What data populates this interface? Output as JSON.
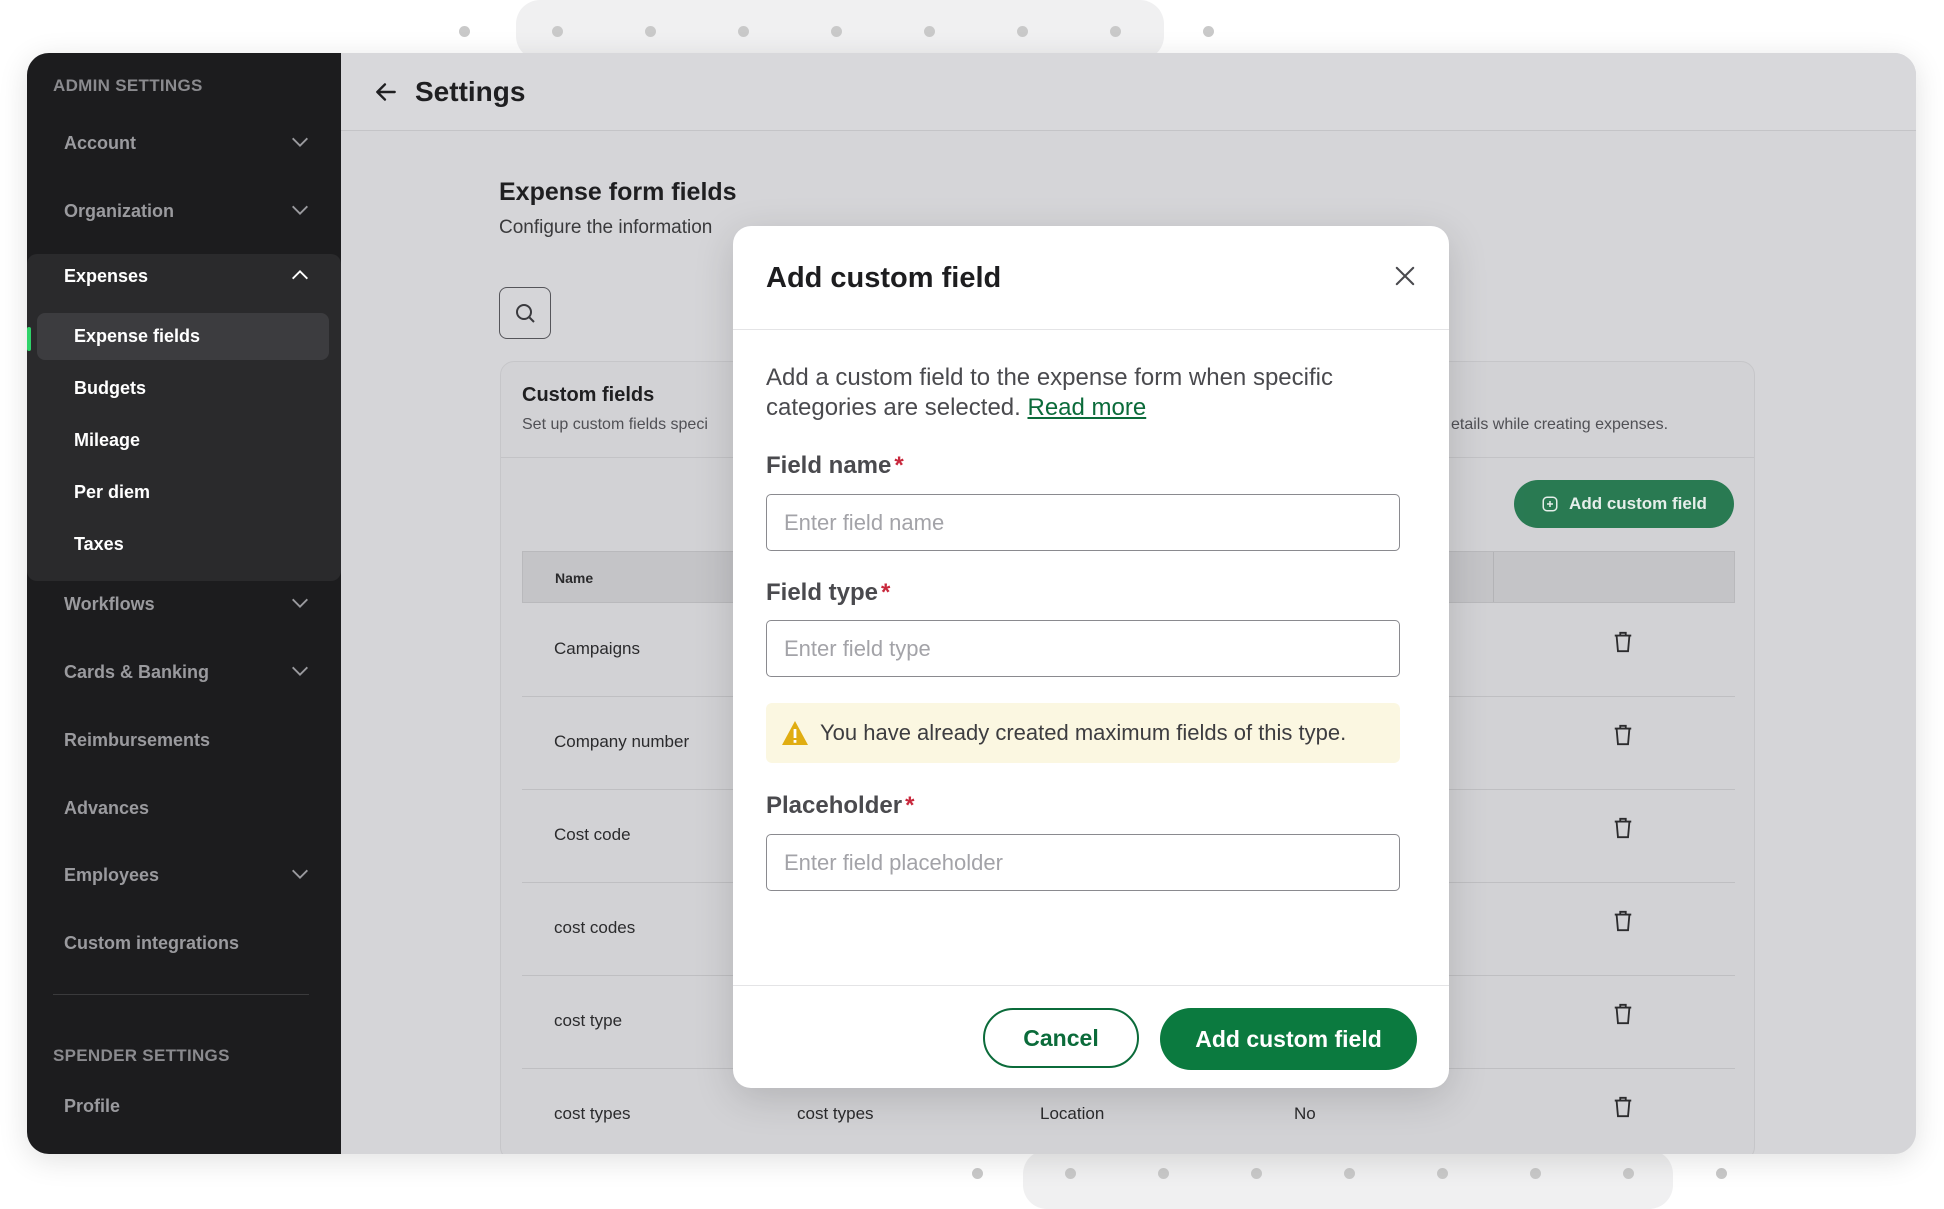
{
  "sidebar": {
    "admin_section": "ADMIN SETTINGS",
    "spender_section": "SPENDER SETTINGS",
    "items": [
      {
        "label": "Account"
      },
      {
        "label": "Organization"
      },
      {
        "label": "Expenses"
      },
      {
        "label": "Workflows"
      },
      {
        "label": "Cards & Banking"
      },
      {
        "label": "Reimbursements"
      },
      {
        "label": "Advances"
      },
      {
        "label": "Employees"
      },
      {
        "label": "Custom integrations"
      }
    ],
    "expenses_sub": [
      {
        "label": "Expense fields"
      },
      {
        "label": "Budgets"
      },
      {
        "label": "Mileage"
      },
      {
        "label": "Per diem"
      },
      {
        "label": "Taxes"
      }
    ],
    "spender_items": [
      {
        "label": "Profile"
      }
    ]
  },
  "header": {
    "title": "Settings"
  },
  "content": {
    "title": "Expense form fields",
    "subtitle": "Configure the information"
  },
  "card": {
    "title": "Custom fields",
    "subtitle": "Set up custom fields speci",
    "subtitle_right": "etails while creating expenses.",
    "add_button": "Add custom field",
    "column_name": "Name",
    "rows": [
      {
        "name": "Campaigns"
      },
      {
        "name": "Company number"
      },
      {
        "name": "Cost code"
      },
      {
        "name": "cost codes"
      },
      {
        "name": "cost type"
      },
      {
        "name": "cost types",
        "col2": "cost types",
        "col3": "Location",
        "col4": "No"
      }
    ]
  },
  "modal": {
    "title": "Add custom field",
    "description": "Add a custom field to the expense form when specific categories are selected.",
    "read_more": "Read more",
    "field_name_label": "Field name",
    "field_name_placeholder": "Enter field name",
    "field_type_label": "Field type",
    "field_type_placeholder": "Enter field type",
    "warning": "You have already created maximum fields of this type.",
    "placeholder_label": "Placeholder",
    "placeholder_placeholder": "Enter field placeholder",
    "required_mark": "*",
    "cancel": "Cancel",
    "submit": "Add custom field"
  },
  "colors": {
    "brand_green": "#0b7a3f",
    "sidebar_bg": "#1c1c1e",
    "active_indicator": "#2fd36a",
    "required": "#c8283c",
    "warning_bg": "#fbf7e1"
  }
}
